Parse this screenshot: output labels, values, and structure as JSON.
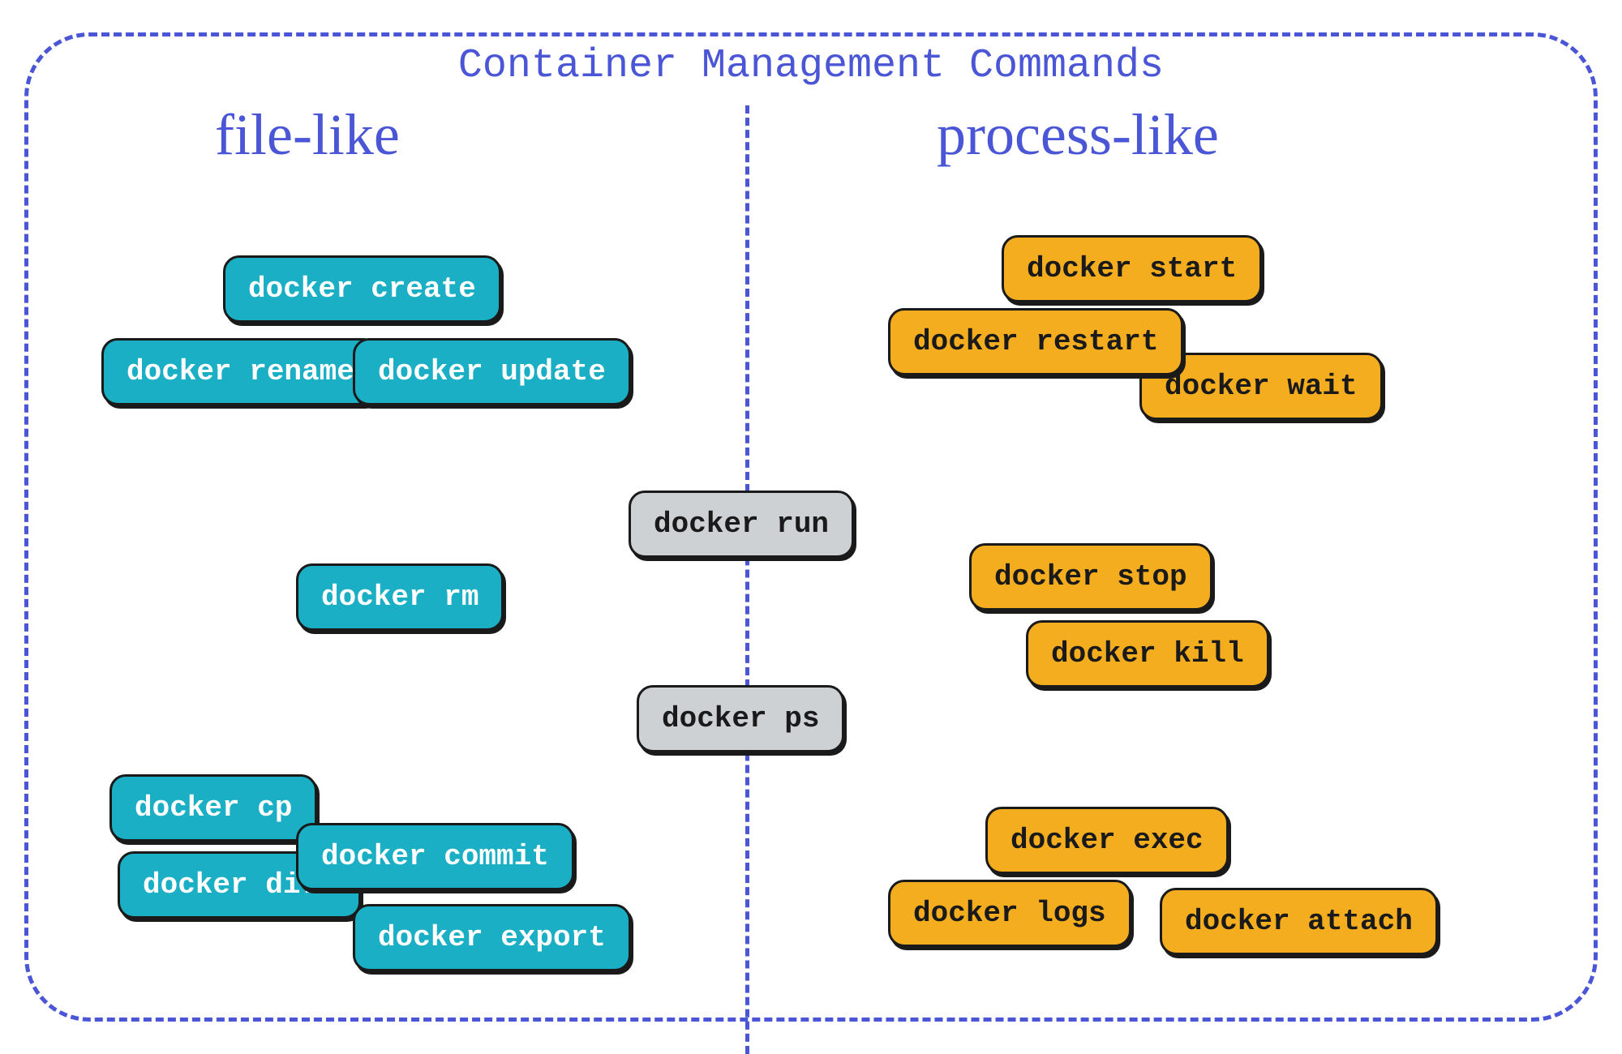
{
  "title": "Container Management Commands",
  "sections": {
    "left": "file-like",
    "right": "process-like"
  },
  "commands": {
    "file_like": {
      "create": "docker create",
      "rename": "docker rename",
      "update": "docker update",
      "rm": "docker rm",
      "cp": "docker cp",
      "diff": "docker diff",
      "commit": "docker commit",
      "export": "docker export"
    },
    "center": {
      "run": "docker run",
      "ps": "docker ps"
    },
    "process_like": {
      "start": "docker start",
      "restart": "docker restart",
      "wait": "docker wait",
      "stop": "docker stop",
      "kill": "docker kill",
      "exec": "docker exec",
      "logs": "docker logs",
      "attach": "docker attach"
    }
  },
  "colors": {
    "border": "#4a56d6",
    "teal": "#1aafc4",
    "orange": "#f4ad1f",
    "gray": "#cdd1d4"
  }
}
